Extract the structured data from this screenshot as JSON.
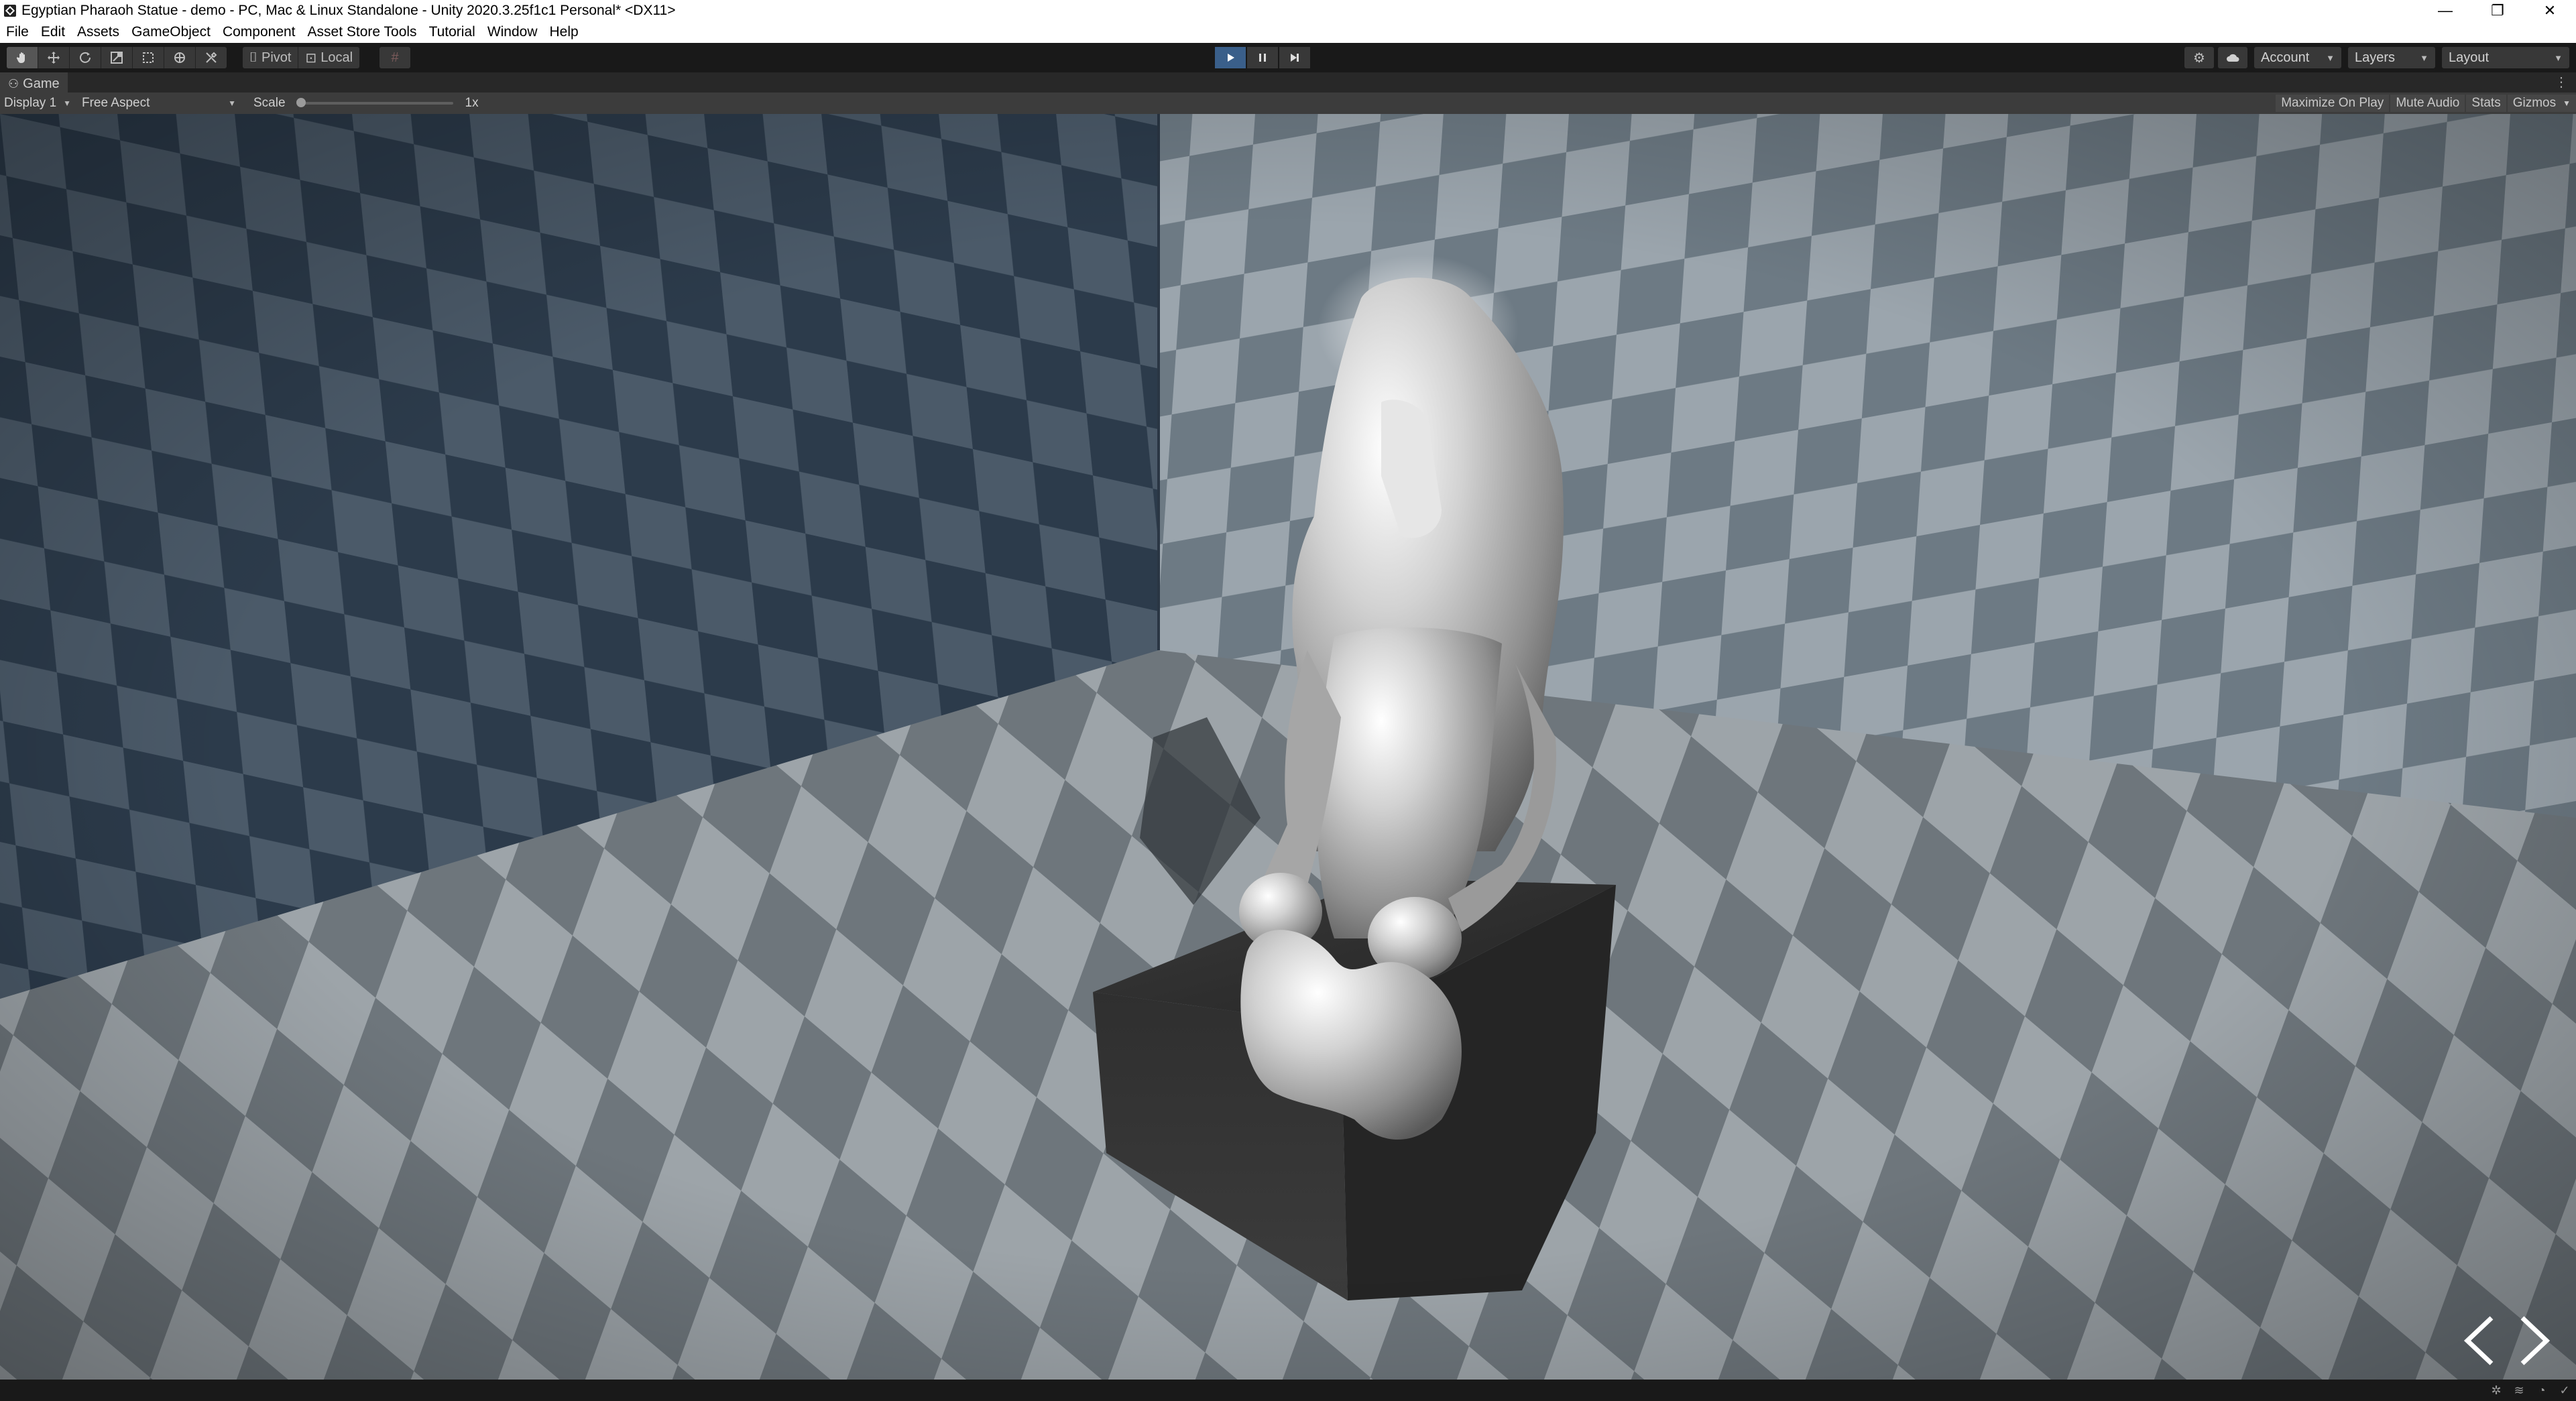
{
  "window": {
    "title": "Egyptian Pharaoh Statue - demo - PC, Mac & Linux Standalone - Unity 2020.3.25f1c1 Personal* <DX11>",
    "controls": [
      "—",
      "❐",
      "✕"
    ]
  },
  "menu": [
    "File",
    "Edit",
    "Assets",
    "GameObject",
    "Component",
    "Asset Store Tools",
    "Tutorial",
    "Window",
    "Help"
  ],
  "toolbar": {
    "tools": [
      "hand-tool-icon",
      "move-tool-icon",
      "rotate-tool-icon",
      "scale-tool-icon",
      "rect-tool-icon",
      "transform-tool-icon",
      "custom-tool-icon"
    ],
    "pivot_label": "Pivot",
    "local_label": "Local",
    "account_label": "Account",
    "layers_label": "Layers",
    "layout_label": "Layout"
  },
  "game_view": {
    "tab_label": "Game",
    "display": "Display 1",
    "aspect": "Free Aspect",
    "scale_label": "Scale",
    "scale_value": "1x",
    "maximize_label": "Maximize On Play",
    "mute_label": "Mute Audio",
    "stats_label": "Stats",
    "gizmos_label": "Gizmos"
  },
  "scene": {
    "subject": "Egyptian pharaoh statue",
    "nav_prev": "<",
    "nav_next": ">",
    "colors": {
      "wall_dark": "#2b3a4a",
      "wall_light": "#4a5968",
      "floor_dark": "#6a7278",
      "floor_light": "#9aa1a6",
      "statue": "#c8c8c8",
      "pedestal": "#2e2e2e"
    }
  }
}
